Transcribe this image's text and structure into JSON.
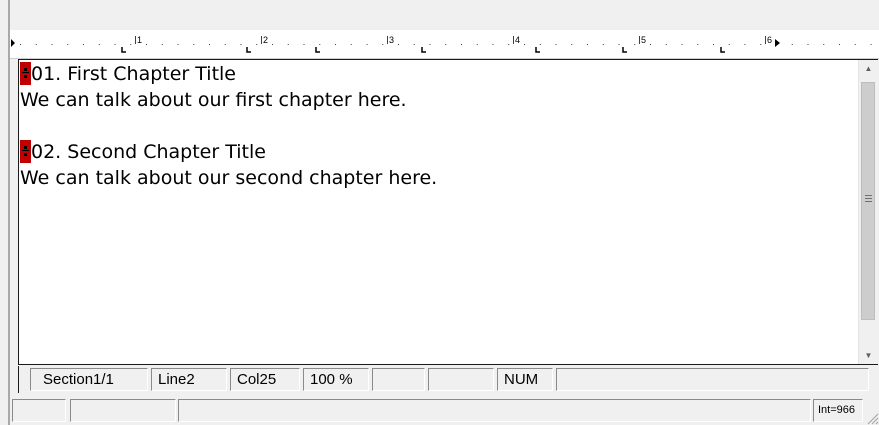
{
  "document": {
    "lines": [
      {
        "text": "01. First Chapter Title",
        "marker": true
      },
      {
        "text": "We can talk about our first chapter here.",
        "marker": false
      },
      {
        "text": "",
        "marker": false
      },
      {
        "text": "02. Second Chapter Title",
        "marker": true
      },
      {
        "text": "We can talk about our second chapter here.",
        "marker": false
      }
    ]
  },
  "ruler": {
    "numbers": [
      "1",
      "2",
      "3",
      "4",
      "5",
      "6"
    ]
  },
  "status_bar": {
    "section": "Section1/1",
    "line": "Line2",
    "col": "Col25",
    "zoom": "100 %",
    "field5": "",
    "field6": "",
    "num": "NUM",
    "field8": ""
  },
  "bottom_bar": {
    "int_value": "Int=966"
  },
  "colors": {
    "marker": "#c00000",
    "editor_bg": "#ffffff",
    "chrome_bg": "#f0f0f0"
  },
  "icons": {
    "scroll_up": "triangle-up-icon",
    "scroll_down": "triangle-down-icon",
    "thumb_grip": "grip-lines-icon",
    "resize": "resize-grip-icon"
  }
}
